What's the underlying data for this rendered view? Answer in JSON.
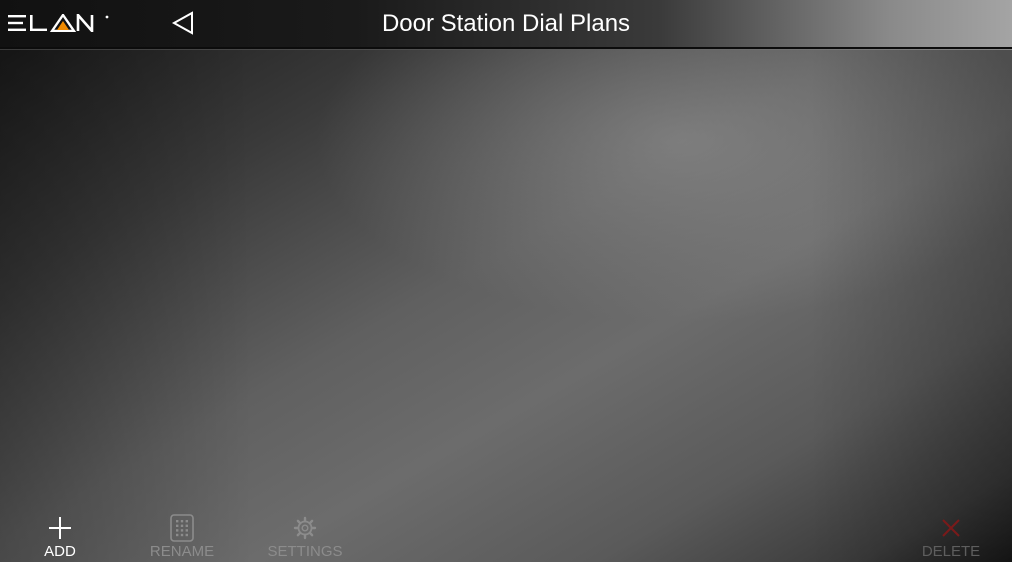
{
  "header": {
    "logo_text": "ELAN",
    "title": "Door Station Dial Plans",
    "back_icon": "back-triangle-icon"
  },
  "toolbar": {
    "items": [
      {
        "label": "ADD",
        "icon": "plus-icon",
        "enabled": true
      },
      {
        "label": "RENAME",
        "icon": "keypad-icon",
        "enabled": false
      },
      {
        "label": "SETTINGS",
        "icon": "gear-icon",
        "enabled": false
      },
      {
        "label": "DELETE",
        "icon": "x-icon",
        "enabled": false
      }
    ]
  },
  "colors": {
    "accent_orange": "#f08a00",
    "text_white": "#ffffff",
    "disabled_text": "#8c8c8c",
    "delete_disabled_red": "#7a1a1a"
  }
}
